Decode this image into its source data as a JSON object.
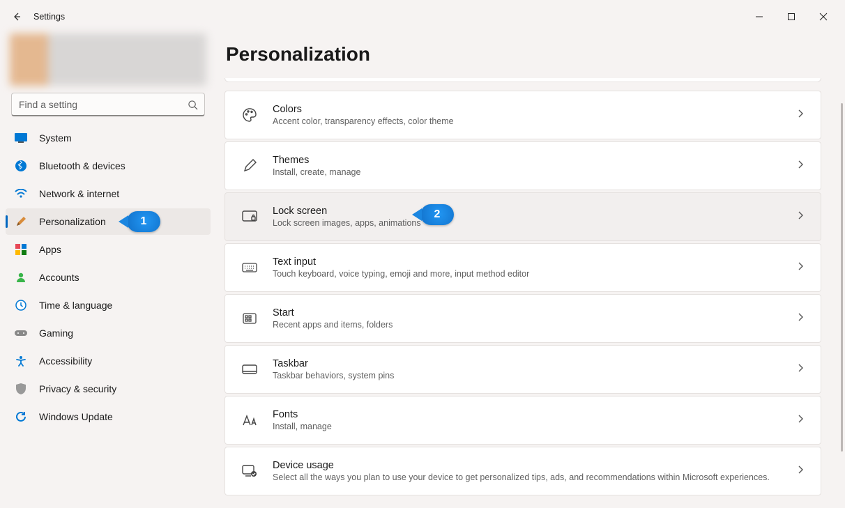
{
  "window": {
    "title": "Settings"
  },
  "search": {
    "placeholder": "Find a setting"
  },
  "sidebar": {
    "items": [
      {
        "id": "system",
        "label": "System"
      },
      {
        "id": "bluetooth",
        "label": "Bluetooth & devices"
      },
      {
        "id": "network",
        "label": "Network & internet"
      },
      {
        "id": "personalization",
        "label": "Personalization"
      },
      {
        "id": "apps",
        "label": "Apps"
      },
      {
        "id": "accounts",
        "label": "Accounts"
      },
      {
        "id": "time",
        "label": "Time & language"
      },
      {
        "id": "gaming",
        "label": "Gaming"
      },
      {
        "id": "accessibility",
        "label": "Accessibility"
      },
      {
        "id": "privacy",
        "label": "Privacy & security"
      },
      {
        "id": "update",
        "label": "Windows Update"
      }
    ],
    "active": "personalization"
  },
  "page": {
    "title": "Personalization"
  },
  "cards": [
    {
      "id": "colors",
      "title": "Colors",
      "subtitle": "Accent color, transparency effects, color theme"
    },
    {
      "id": "themes",
      "title": "Themes",
      "subtitle": "Install, create, manage"
    },
    {
      "id": "lockscreen",
      "title": "Lock screen",
      "subtitle": "Lock screen images, apps, animations"
    },
    {
      "id": "textinput",
      "title": "Text input",
      "subtitle": "Touch keyboard, voice typing, emoji and more, input method editor"
    },
    {
      "id": "start",
      "title": "Start",
      "subtitle": "Recent apps and items, folders"
    },
    {
      "id": "taskbar",
      "title": "Taskbar",
      "subtitle": "Taskbar behaviors, system pins"
    },
    {
      "id": "fonts",
      "title": "Fonts",
      "subtitle": "Install, manage"
    },
    {
      "id": "deviceusage",
      "title": "Device usage",
      "subtitle": "Select all the ways you plan to use your device to get personalized tips, ads, and recommendations within Microsoft experiences."
    }
  ],
  "annotations": {
    "one": "1",
    "two": "2"
  }
}
